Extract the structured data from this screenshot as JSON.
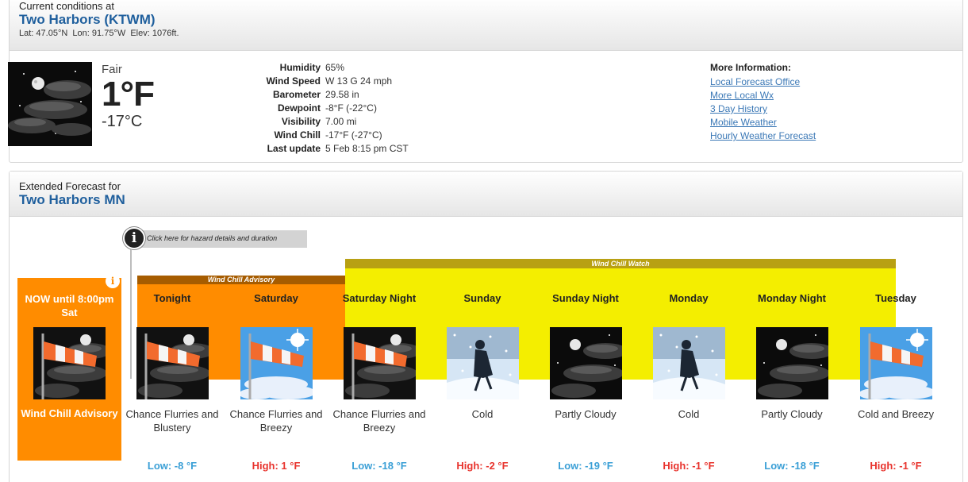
{
  "current": {
    "heading": "Current conditions at",
    "station": "Two Harbors (KTWM)",
    "lat_label": "Lat:",
    "lat": "47.05°N",
    "lon_label": "Lon:",
    "lon": "91.75°W",
    "elev_label": "Elev:",
    "elev": "1076ft.",
    "condition": "Fair",
    "temp_f": "1°F",
    "temp_c": "-17°C",
    "details": [
      {
        "label": "Humidity",
        "value": "65%"
      },
      {
        "label": "Wind Speed",
        "value": "W 13 G 24 mph"
      },
      {
        "label": "Barometer",
        "value": "29.58 in"
      },
      {
        "label": "Dewpoint",
        "value": "-8°F (-22°C)"
      },
      {
        "label": "Visibility",
        "value": "7.00 mi"
      },
      {
        "label": "Wind Chill",
        "value": "-17°F (-27°C)"
      },
      {
        "label": "Last update",
        "value": "5 Feb 8:15 pm CST"
      }
    ],
    "more_info": {
      "heading": "More Information:",
      "links": [
        "Local Forecast Office",
        "More Local Wx",
        "3 Day History",
        "Mobile Weather",
        "Hourly Weather Forecast"
      ]
    },
    "icon": "night-fair-moon-icon"
  },
  "extended": {
    "heading": "Extended Forecast for",
    "location": "Two Harbors MN",
    "hazard_callout": "Click here for hazard details and duration",
    "advisory_label": "Wind Chill Advisory",
    "watch_label": "Wind Chill Watch",
    "colors": {
      "advisory": "#ff8c00",
      "advisory_bar": "#a65c00",
      "watch": "#f4ee00",
      "watch_bar": "#b8a013",
      "low": "#3a9fd6",
      "high": "#e8332d"
    },
    "now": {
      "title": "NOW until 8:00pm Sat",
      "hazard": "Wind Chill Advisory",
      "icon": "windsock-night-icon"
    },
    "periods": [
      {
        "name": "Tonight",
        "desc": "Chance Flurries and Blustery",
        "temp": "Low: -8 °F",
        "kind": "low",
        "icon": "windsock-night-icon"
      },
      {
        "name": "Saturday",
        "desc": "Chance Flurries and Breezy",
        "temp": "High: 1 °F",
        "kind": "high",
        "icon": "windsock-day-icon"
      },
      {
        "name": "Saturday Night",
        "desc": "Chance Flurries and Breezy",
        "temp": "Low: -18 °F",
        "kind": "low",
        "icon": "windsock-night-icon"
      },
      {
        "name": "Sunday",
        "desc": "Cold",
        "temp": "High: -2 °F",
        "kind": "high",
        "icon": "cold-person-icon"
      },
      {
        "name": "Sunday Night",
        "desc": "Partly Cloudy",
        "temp": "Low: -19 °F",
        "kind": "low",
        "icon": "night-partly-cloudy-icon"
      },
      {
        "name": "Monday",
        "desc": "Cold",
        "temp": "High: -1 °F",
        "kind": "high",
        "icon": "cold-person-icon"
      },
      {
        "name": "Monday Night",
        "desc": "Partly Cloudy",
        "temp": "Low: -18 °F",
        "kind": "low",
        "icon": "night-partly-cloudy-icon"
      },
      {
        "name": "Tuesday",
        "desc": "Cold and Breezy",
        "temp": "High: -1 °F",
        "kind": "high",
        "icon": "windsock-day-icon"
      }
    ]
  }
}
